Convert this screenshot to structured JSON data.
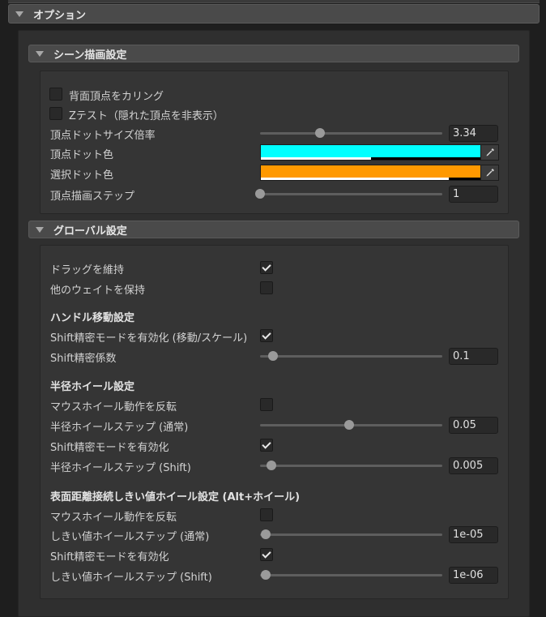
{
  "options": {
    "title": "オプション",
    "scene": {
      "title": "シーン描画設定",
      "cull_backface": {
        "label": "背面頂点をカリング",
        "checked": false
      },
      "ztest": {
        "label": "Zテスト（隠れた頂点を非表示）",
        "checked": false
      },
      "dot_size": {
        "label": "頂点ドットサイズ倍率",
        "value": "3.34",
        "fraction": 0.33
      },
      "dot_color": {
        "label": "頂点ドット色",
        "color": "#00ffff"
      },
      "selected_color": {
        "label": "選択ドット色",
        "color": "#ff9900"
      },
      "draw_step": {
        "label": "頂点描画ステップ",
        "value": "1",
        "fraction": 0.0
      }
    },
    "global": {
      "title": "グローバル設定",
      "keep_drag": {
        "label": "ドラッグを維持",
        "checked": true
      },
      "keep_other_weights": {
        "label": "他のウェイトを保持",
        "checked": false
      },
      "handle": {
        "header": "ハンドル移動設定",
        "shift_precision": {
          "label": "Shift精密モードを有効化 (移動/スケール)",
          "checked": true
        },
        "shift_factor": {
          "label": "Shift精密係数",
          "value": "0.1",
          "fraction": 0.07
        }
      },
      "radius": {
        "header": "半径ホイール設定",
        "invert": {
          "label": "マウスホイール動作を反転",
          "checked": false
        },
        "step_normal": {
          "label": "半径ホイールステップ (通常)",
          "value": "0.05",
          "fraction": 0.49
        },
        "shift_precision": {
          "label": "Shift精密モードを有効化",
          "checked": true
        },
        "step_shift": {
          "label": "半径ホイールステップ (Shift)",
          "value": "0.005",
          "fraction": 0.06
        }
      },
      "threshold": {
        "header": "表面距離接続しきい値ホイール設定 (Alt+ホイール)",
        "invert": {
          "label": "マウスホイール動作を反転",
          "checked": false
        },
        "step_normal": {
          "label": "しきい値ホイールステップ (通常)",
          "value": "1e-05",
          "fraction": 0.03
        },
        "shift_precision": {
          "label": "Shift精密モードを有効化",
          "checked": true
        },
        "step_shift": {
          "label": "しきい値ホイールステップ (Shift)",
          "value": "1e-06",
          "fraction": 0.03
        }
      }
    }
  },
  "icons": {
    "fold": "triangle-down-icon",
    "eyedropper": "eyedropper-icon",
    "check": "checkmark-icon"
  }
}
